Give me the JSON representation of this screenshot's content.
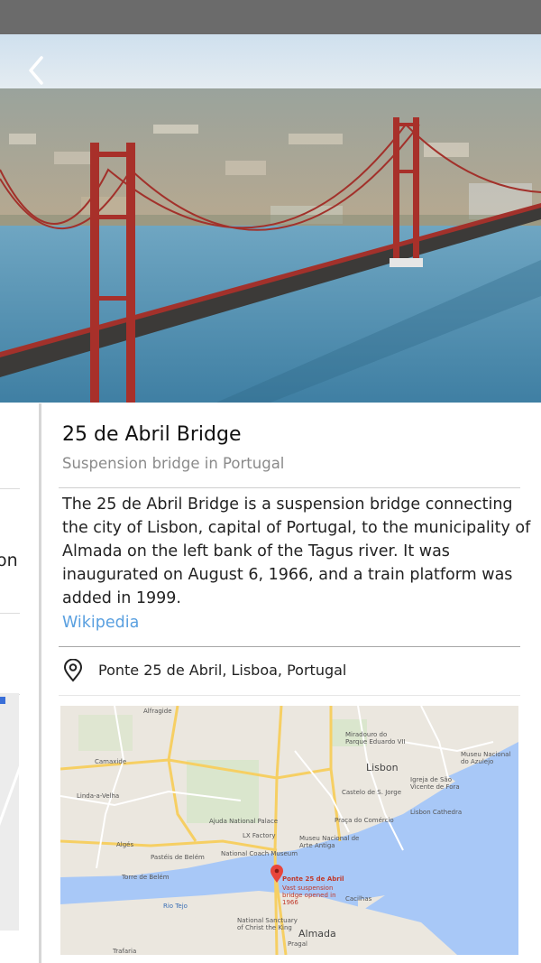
{
  "place": {
    "title": "25 de Abril Bridge",
    "subtitle": "Suspension bridge in Portugal",
    "description": "The 25 de Abril Bridge is a suspension bridge connecting the city of Lisbon, capital of Portugal, to the municipality of Almada on the left bank of the Tagus river. It was inaugurated on August 6, 1966, and a train platform was added in 1999.",
    "source_link": "Wikipedia",
    "address": "Ponte 25 de Abril, Lisboa, Portugal"
  },
  "prev_card": {
    "text_fragment": "on"
  },
  "map": {
    "labels": {
      "alfragide": "Alfragide",
      "lisbon": "Lisbon",
      "camaxide": "Camaxide",
      "linda": "Linda-a-Velha",
      "miradouro": "Miradouro do Parque Eduardo VII",
      "azulejo": "Museu Nacional do Azulejo",
      "igreja": "Igreja de São Vicente de Fora",
      "castelo": "Castelo de S. Jorge",
      "cathedra": "Lisbon Cathedra",
      "praca": "Praça do Comércio",
      "arte": "Museu Nacional de Arte Antiga",
      "ajuda": "Ajuda National Palace",
      "lxfactory": "LX Factory",
      "coach": "National Coach Museum",
      "pasteis": "Pastéis de Belém",
      "algés": "Algés",
      "torre": "Torre de Belém",
      "bridge": "Ponte 25 de Abril",
      "bridge_sub": "Vast suspension bridge opened in 1966",
      "sanctuary": "National Sanctuary of Christ the King",
      "almada": "Almada",
      "cacilhas": "Cacilhas",
      "pragal": "Pragal",
      "trafaria": "Trafaria",
      "rio": "Rio Tejo"
    }
  }
}
